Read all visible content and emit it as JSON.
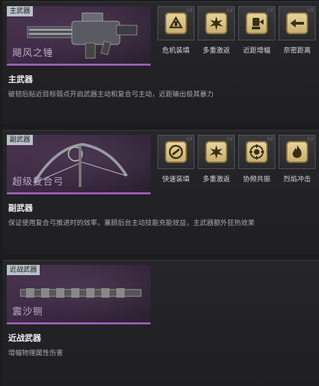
{
  "primary": {
    "slot_tag": "主武器",
    "weapon_name": "飓风之锤",
    "title": "主武器",
    "description": "破韧后贴近目标弱点开启武器主动和复合弓主动，近距输出极其暴力",
    "perks": [
      {
        "label": "危机装填",
        "icon": "reload-crisis-icon"
      },
      {
        "label": "多重激返",
        "icon": "multi-burst-icon"
      },
      {
        "label": "近距增幅",
        "icon": "close-range-boost-icon"
      },
      {
        "label": "奈密距离",
        "icon": "distance-icon"
      }
    ]
  },
  "secondary": {
    "slot_tag": "副武器",
    "weapon_name": "超级复合弓",
    "title": "副武器",
    "description": "保证使用复合弓推进时的效率，兼顾后台主动技能充能效益，主武器额外狂热效果",
    "perks": [
      {
        "label": "快速装填",
        "icon": "quick-reload-icon"
      },
      {
        "label": "多重激返",
        "icon": "multi-burst-icon"
      },
      {
        "label": "协频共振",
        "icon": "resonance-icon"
      },
      {
        "label": "烈焰冲击",
        "icon": "flame-impact-icon"
      }
    ]
  },
  "melee": {
    "slot_tag": "近战武器",
    "weapon_name": "震沙铡",
    "title": "近战武器",
    "description": "增幅物理属性伤害"
  },
  "colors": {
    "accent": "#9b5fb8",
    "perk_gold": "#d8c080",
    "background": "#1c1c1e"
  }
}
